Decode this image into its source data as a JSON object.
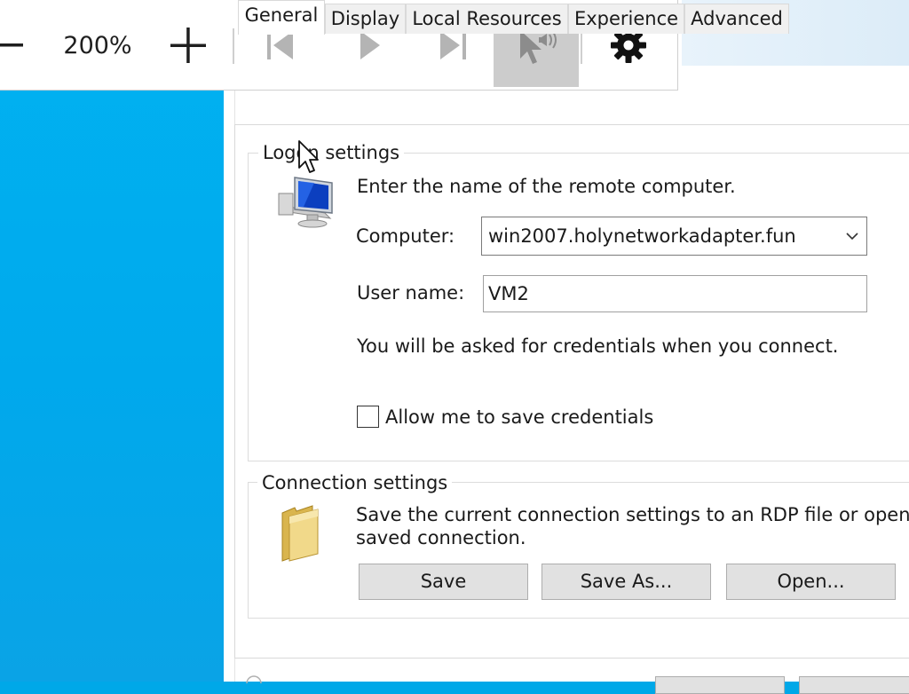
{
  "toolbar": {
    "zoom_out_icon": "minus-icon",
    "zoom_level": "200%",
    "zoom_in_icon": "plus-icon",
    "skip_back_icon": "skip-back-icon",
    "play_icon": "play-icon",
    "skip_forward_icon": "skip-forward-icon",
    "pointer_audio_icon": "pointer-audio-icon",
    "settings_icon": "gear-icon"
  },
  "tabs": [
    {
      "label": "General",
      "selected": true
    },
    {
      "label": "Display",
      "selected": false
    },
    {
      "label": "Local Resources",
      "selected": false
    },
    {
      "label": "Experience",
      "selected": false
    },
    {
      "label": "Advanced",
      "selected": false
    }
  ],
  "logon": {
    "legend": "Logon settings",
    "instruction": "Enter the name of the remote computer.",
    "computer_label": "Computer:",
    "computer_value": "win2007.holynetworkadapter.fun",
    "username_label": "User name:",
    "username_value": "VM2",
    "credentials_note": "You will be asked for credentials when you connect.",
    "save_credentials_label": "Allow me to save credentials",
    "save_credentials_checked": false
  },
  "connection": {
    "legend": "Connection settings",
    "description_line1": "Save the current connection settings to an RDP file or open a",
    "description_line2": "saved connection.",
    "save_label": "Save",
    "save_as_label": "Save As...",
    "open_label": "Open..."
  },
  "colors": {
    "desktop": "#01b2f1",
    "button_face": "#e1e1e1",
    "active_toolbar_button": "#cccccc"
  }
}
